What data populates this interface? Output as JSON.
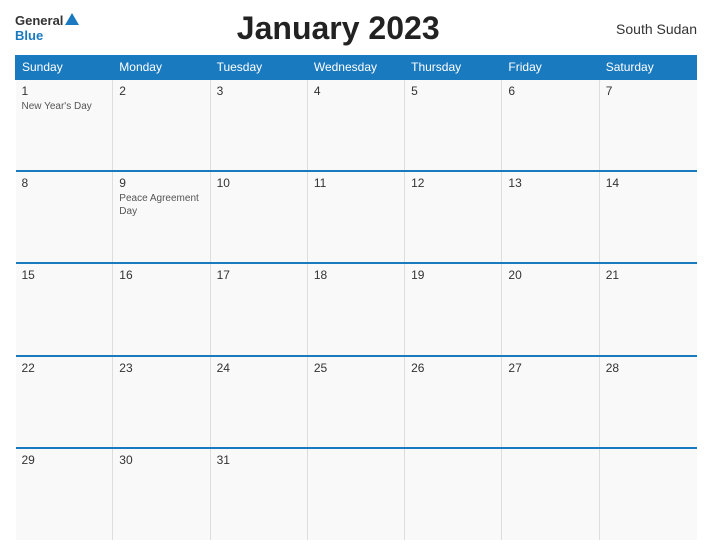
{
  "header": {
    "logo_general": "General",
    "logo_blue": "Blue",
    "title": "January 2023",
    "country": "South Sudan"
  },
  "calendar": {
    "days_of_week": [
      "Sunday",
      "Monday",
      "Tuesday",
      "Wednesday",
      "Thursday",
      "Friday",
      "Saturday"
    ],
    "weeks": [
      [
        {
          "day": "1",
          "holiday": "New Year's Day"
        },
        {
          "day": "2",
          "holiday": ""
        },
        {
          "day": "3",
          "holiday": ""
        },
        {
          "day": "4",
          "holiday": ""
        },
        {
          "day": "5",
          "holiday": ""
        },
        {
          "day": "6",
          "holiday": ""
        },
        {
          "day": "7",
          "holiday": ""
        }
      ],
      [
        {
          "day": "8",
          "holiday": ""
        },
        {
          "day": "9",
          "holiday": "Peace Agreement Day"
        },
        {
          "day": "10",
          "holiday": ""
        },
        {
          "day": "11",
          "holiday": ""
        },
        {
          "day": "12",
          "holiday": ""
        },
        {
          "day": "13",
          "holiday": ""
        },
        {
          "day": "14",
          "holiday": ""
        }
      ],
      [
        {
          "day": "15",
          "holiday": ""
        },
        {
          "day": "16",
          "holiday": ""
        },
        {
          "day": "17",
          "holiday": ""
        },
        {
          "day": "18",
          "holiday": ""
        },
        {
          "day": "19",
          "holiday": ""
        },
        {
          "day": "20",
          "holiday": ""
        },
        {
          "day": "21",
          "holiday": ""
        }
      ],
      [
        {
          "day": "22",
          "holiday": ""
        },
        {
          "day": "23",
          "holiday": ""
        },
        {
          "day": "24",
          "holiday": ""
        },
        {
          "day": "25",
          "holiday": ""
        },
        {
          "day": "26",
          "holiday": ""
        },
        {
          "day": "27",
          "holiday": ""
        },
        {
          "day": "28",
          "holiday": ""
        }
      ],
      [
        {
          "day": "29",
          "holiday": ""
        },
        {
          "day": "30",
          "holiday": ""
        },
        {
          "day": "31",
          "holiday": ""
        },
        {
          "day": "",
          "holiday": ""
        },
        {
          "day": "",
          "holiday": ""
        },
        {
          "day": "",
          "holiday": ""
        },
        {
          "day": "",
          "holiday": ""
        }
      ]
    ]
  }
}
